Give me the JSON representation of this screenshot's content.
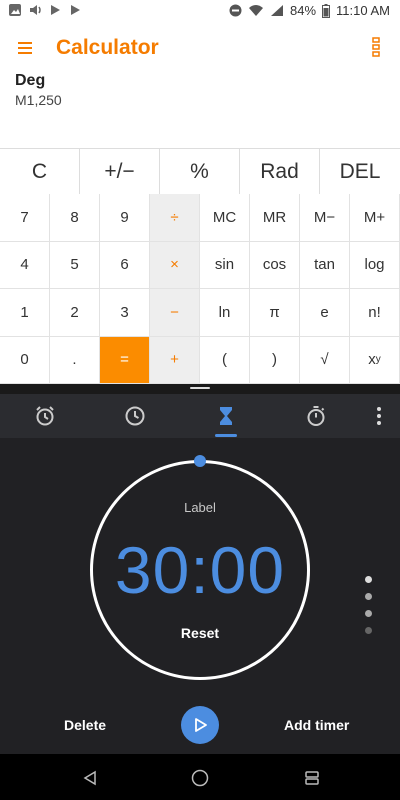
{
  "status_bar": {
    "battery": "84%",
    "time": "11:10 AM"
  },
  "calculator": {
    "title": "Calculator",
    "display": {
      "mode": "Deg",
      "memory": "M1,250"
    },
    "top_row": [
      "C",
      "+/−",
      "%",
      "Rad",
      "DEL"
    ],
    "grid": [
      [
        "7",
        "8",
        "9",
        "÷",
        "MC",
        "MR",
        "M−",
        "M+"
      ],
      [
        "4",
        "5",
        "6",
        "×",
        "sin",
        "cos",
        "tan",
        "log"
      ],
      [
        "1",
        "2",
        "3",
        "−",
        "ln",
        "π",
        "e",
        "n!"
      ],
      [
        "0",
        ".",
        "=",
        "+",
        "(",
        ")",
        "√",
        "x"
      ]
    ],
    "power_superscript": "y",
    "accent": "#f57c00"
  },
  "clock": {
    "label": "Label",
    "time": "30:00",
    "reset": "Reset",
    "delete": "Delete",
    "add_timer": "Add timer",
    "active_tab": "timer",
    "accent": "#4c8de0",
    "tabs": [
      "alarm-icon",
      "clock-icon",
      "hourglass-icon",
      "stopwatch-icon"
    ],
    "page_dots": 4
  }
}
